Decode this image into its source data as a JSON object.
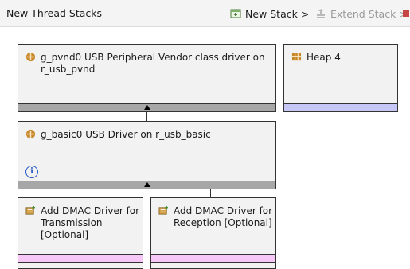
{
  "header": {
    "title": "New Thread Stacks",
    "new_stack_label": "New Stack >",
    "extend_stack_label": "Extend Stack >"
  },
  "stacks": {
    "pvnd": {
      "icon": "module-icon",
      "line1": "g_pvnd0 USB Peripheral Vendor class driver on",
      "line2": "r_usb_pvnd"
    },
    "heap": {
      "icon": "heap-icon",
      "label": "Heap 4"
    },
    "basic": {
      "icon": "module-icon",
      "label": "g_basic0 USB Driver on r_usb_basic",
      "info_icon": "info-icon"
    },
    "dmac_tx": {
      "icon": "add-driver-icon",
      "line1": "Add DMAC Driver for",
      "line2": "Transmission",
      "line3": "[Optional]"
    },
    "dmac_rx": {
      "icon": "add-driver-icon",
      "line1": "Add DMAC Driver for",
      "line2": "Reception [Optional]"
    }
  },
  "colors": {
    "box_bg": "#f2f2f2",
    "footer_gray": "#a7a7a7",
    "footer_lavender": "#c6c6f7",
    "footer_pink": "#f7c7f7",
    "info_blue": "#2358c4",
    "module_icon": "#c9892b"
  }
}
